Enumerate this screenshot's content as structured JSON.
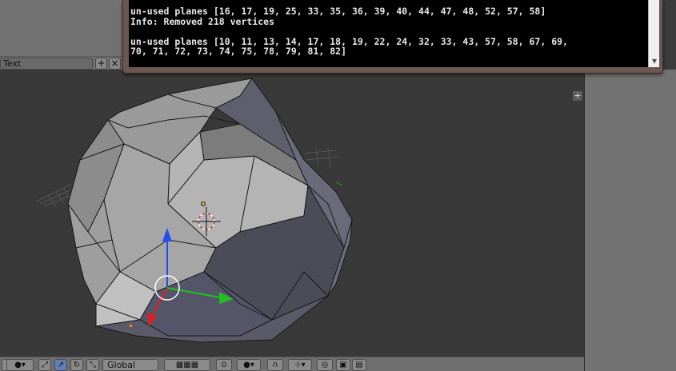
{
  "console": {
    "lines": [
      "un-used planes [16, 17, 19, 25, 33, 35, 36, 39, 40, 44, 47, 48, 52, 57, 58]",
      "Info: Removed 218 vertices",
      "",
      "un-used planes [10, 11, 13, 14, 17, 18, 19, 22, 24, 32, 33, 43, 57, 58, 67, 69,",
      "70, 71, 72, 73, 74, 75, 78, 79, 81, 82]"
    ],
    "scroll_down_icon": "triangle-down"
  },
  "text_editor_header": {
    "field_value": "Text",
    "add_icon": "plus",
    "close_icon": "x"
  },
  "viewport": {
    "add_icon": "plus"
  },
  "bottom_header": {
    "orientation": "Global",
    "icons": [
      "mode-dropdown",
      "viewport-shading-dropdown",
      "manipulator-toggle",
      "translate-manipulator",
      "rotate-manipulator",
      "scale-manipulator",
      "orientation-dropdown",
      "layer-buttons",
      "pivot-point",
      "snap-toggle",
      "snap-element",
      "proportional-edit",
      "render-button",
      "camera-button"
    ]
  },
  "colors": {
    "console_bg": "#000000",
    "console_text": "#e8e8e8",
    "console_frame": "#6b5752",
    "viewport_bg": "#393939",
    "panel_bg": "#727272",
    "mesh_light": "#a6a6a6",
    "mesh_dark": "#4a4a58",
    "axis_x": "#e02020",
    "axis_y": "#20c020",
    "axis_z": "#2040e0"
  }
}
